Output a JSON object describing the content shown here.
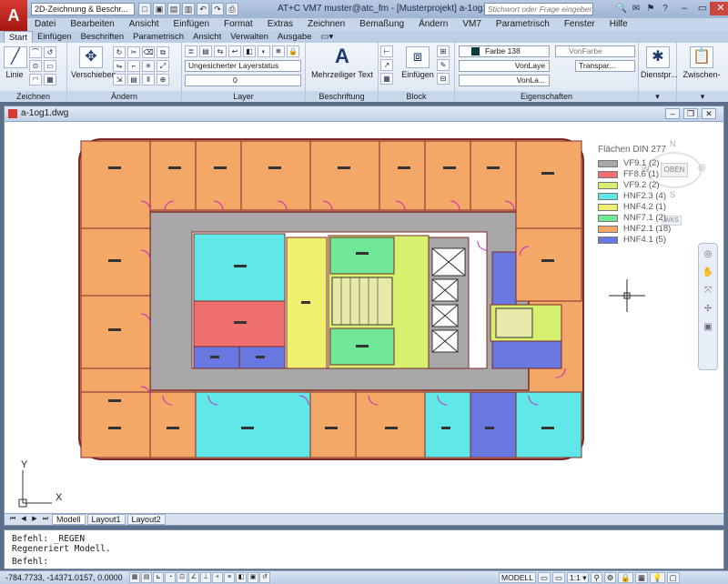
{
  "title_bar": {
    "workspace": "2D-Zeichnung & Beschr...",
    "window_title": "AT+C VM7     muster@atc_fm - [Musterprojekt]    a-1og1.dwg",
    "search_placeholder": "Stichwort oder Frage eingeben",
    "qat": [
      "□",
      "▣",
      "▤",
      "▥",
      "↶",
      "↷",
      "⎙"
    ],
    "icons": [
      "🔍",
      "✉",
      "⚑",
      "?"
    ]
  },
  "menu": [
    "Datei",
    "Bearbeiten",
    "Ansicht",
    "Einfügen",
    "Format",
    "Extras",
    "Zeichnen",
    "Bemaßung",
    "Ändern",
    "VM7",
    "Parametrisch",
    "Fenster",
    "Hilfe"
  ],
  "ribbon_tabs": [
    "Start",
    "Einfügen",
    "Beschriften",
    "Parametrisch",
    "Ansicht",
    "Verwalten",
    "Ausgabe",
    "▭▾"
  ],
  "ribbon": {
    "zeichnen": {
      "label": "Zeichnen",
      "line": "Linie"
    },
    "aendern": {
      "label": "Ändern",
      "move": "Verschieben"
    },
    "layer": {
      "label": "Layer",
      "state": "Ungesicherter Layerstatus",
      "current": "0"
    },
    "beschriftung": {
      "label": "Beschriftung",
      "mtext": "Mehrzeiliger Text"
    },
    "block": {
      "label": "Block",
      "insert": "Einfügen"
    },
    "eigenschaften": {
      "label": "Eigenschaften",
      "color": "Farbe 138",
      "color2": "VonFarbe",
      "linetype": "VonLaye",
      "lineweight": "VonLa...",
      "transparency": "Transpar..."
    },
    "dienst": "Dienstpr...",
    "clipboard": "Zwischen-"
  },
  "document": {
    "title": "a-1og1.dwg",
    "legend_title": "Flächen DIN 277",
    "legend": [
      {
        "label": "VF9.1 (2)",
        "color": "#a8a8a8"
      },
      {
        "label": "FF8.6 (1)",
        "color": "#f07070"
      },
      {
        "label": "VF9.2 (2)",
        "color": "#d8f070"
      },
      {
        "label": "HNF2.3 (4)",
        "color": "#60e8e8"
      },
      {
        "label": "HNF4.2 (1)",
        "color": "#f0f070"
      },
      {
        "label": "NNF7.1 (2)",
        "color": "#70e898"
      },
      {
        "label": "HNF2.1 (18)",
        "color": "#f4a868"
      },
      {
        "label": "HNF4.1 (5)",
        "color": "#6878e0"
      }
    ],
    "compass": {
      "n": "N",
      "s": "S",
      "w": "W",
      "top": "OBEN",
      "wcs": "WKS"
    },
    "ucs_x": "X",
    "ucs_y": "Y",
    "layout_tabs": [
      "Modell",
      "Layout1",
      "Layout2"
    ]
  },
  "command": {
    "line1": "Befehl: _REGEN",
    "line2": "Regeneriert Modell.",
    "prompt": "Befehl:"
  },
  "status": {
    "coords": "-784.7733, -14371.0157, 0.0000",
    "model": "MODELL",
    "scale": "1:1 ▾"
  }
}
